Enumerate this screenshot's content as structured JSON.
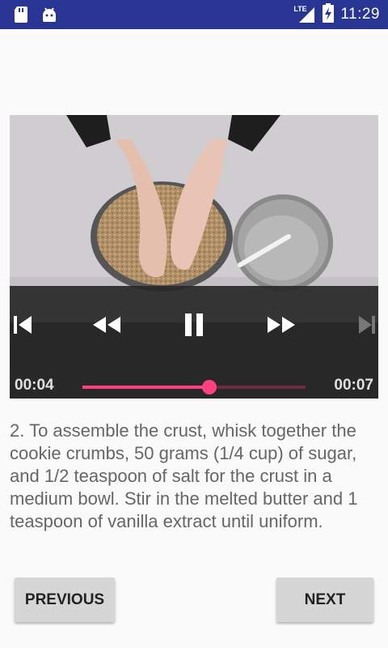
{
  "status_bar": {
    "time": "11:29",
    "network": "LTE",
    "icons": [
      "sd-card-icon",
      "android-icon",
      "lte-signal-icon",
      "battery-charging-icon"
    ]
  },
  "player": {
    "current_time": "00:04",
    "duration": "00:07",
    "progress": 0.57,
    "controls": [
      "skip-previous-icon",
      "rewind-icon",
      "pause-icon",
      "fast-forward-icon",
      "skip-next-icon"
    ]
  },
  "step": {
    "description": "2. To assemble the crust, whisk together the cookie crumbs, 50 grams (1/4 cup) of sugar, and 1/2 teaspoon of salt for the crust in a medium bowl. Stir in the melted butter and 1 teaspoon of vanilla extract until uniform."
  },
  "navigation": {
    "previous_label": "PREVIOUS",
    "next_label": "NEXT"
  },
  "colors": {
    "status_bar": "#283593",
    "accent": "#ff4081",
    "button": "#d6d6d6",
    "text": "#666666"
  }
}
